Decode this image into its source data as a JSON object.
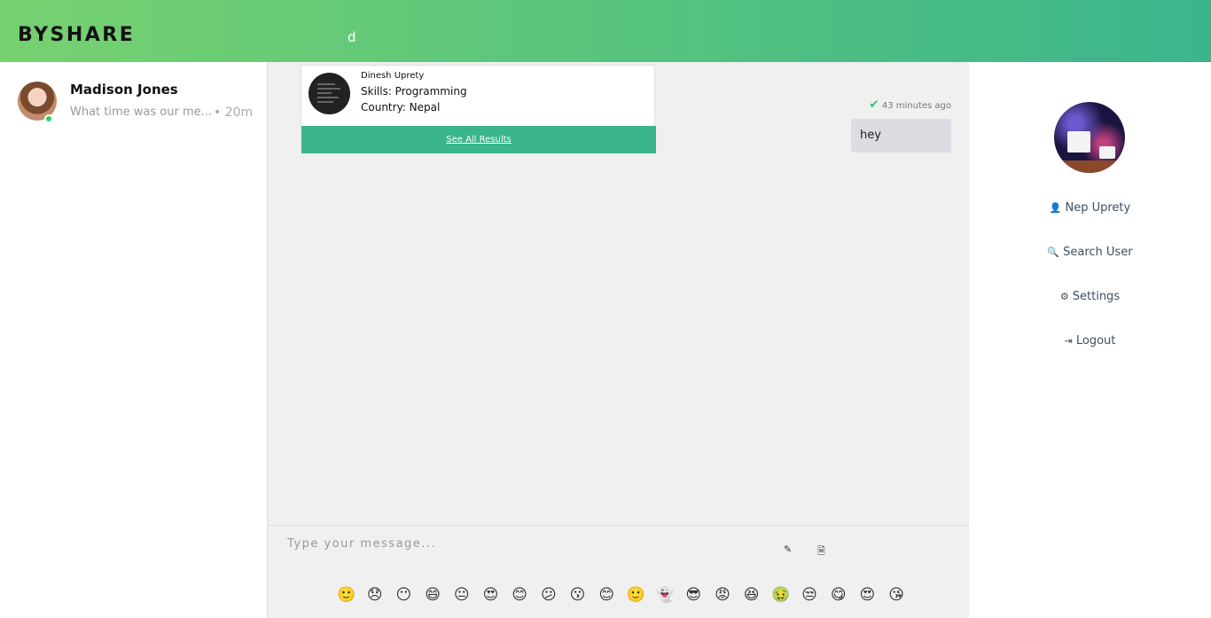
{
  "header": {
    "brand": "BYSHARE",
    "search_value": "d"
  },
  "sidebar_left": {
    "contacts": [
      {
        "name": "Madison Jones",
        "preview": "What time was our me...",
        "time": "• 20m",
        "online": true
      }
    ]
  },
  "search_results": {
    "items": [
      {
        "name": "Dinesh Uprety",
        "skills": "Skills: Programming",
        "country": "Country: Nepal"
      }
    ],
    "see_all_label": "See All Results"
  },
  "chat": {
    "messages": [
      {
        "text": "hey",
        "time": "43 minutes ago",
        "status_icon": "check-icon"
      }
    ],
    "composer": {
      "placeholder": "Type your message...",
      "attach_icon": "paperclip-icon",
      "file_icon": "file-icon"
    },
    "emojis": [
      "🙂",
      "😞",
      "😶",
      "😄",
      "😐",
      "😍",
      "😊",
      "😕",
      "😗",
      "😊",
      "🙂",
      "👻",
      "😎",
      "😡",
      "😆",
      "🤢",
      "😒",
      "😋",
      "😍",
      "😘"
    ]
  },
  "sidebar_right": {
    "profile_name": "Nep Uprety",
    "menu": [
      {
        "label": "Nep Uprety",
        "icon": "user-icon"
      },
      {
        "label": "Search User",
        "icon": "search-icon"
      },
      {
        "label": "Settings",
        "icon": "gears-icon"
      },
      {
        "label": "Logout",
        "icon": "logout-icon"
      }
    ]
  },
  "colors": {
    "header_gradient_start": "#77d170",
    "header_gradient_end": "#3bb58c",
    "accent": "#3bb58c",
    "online": "#2ecc71"
  }
}
